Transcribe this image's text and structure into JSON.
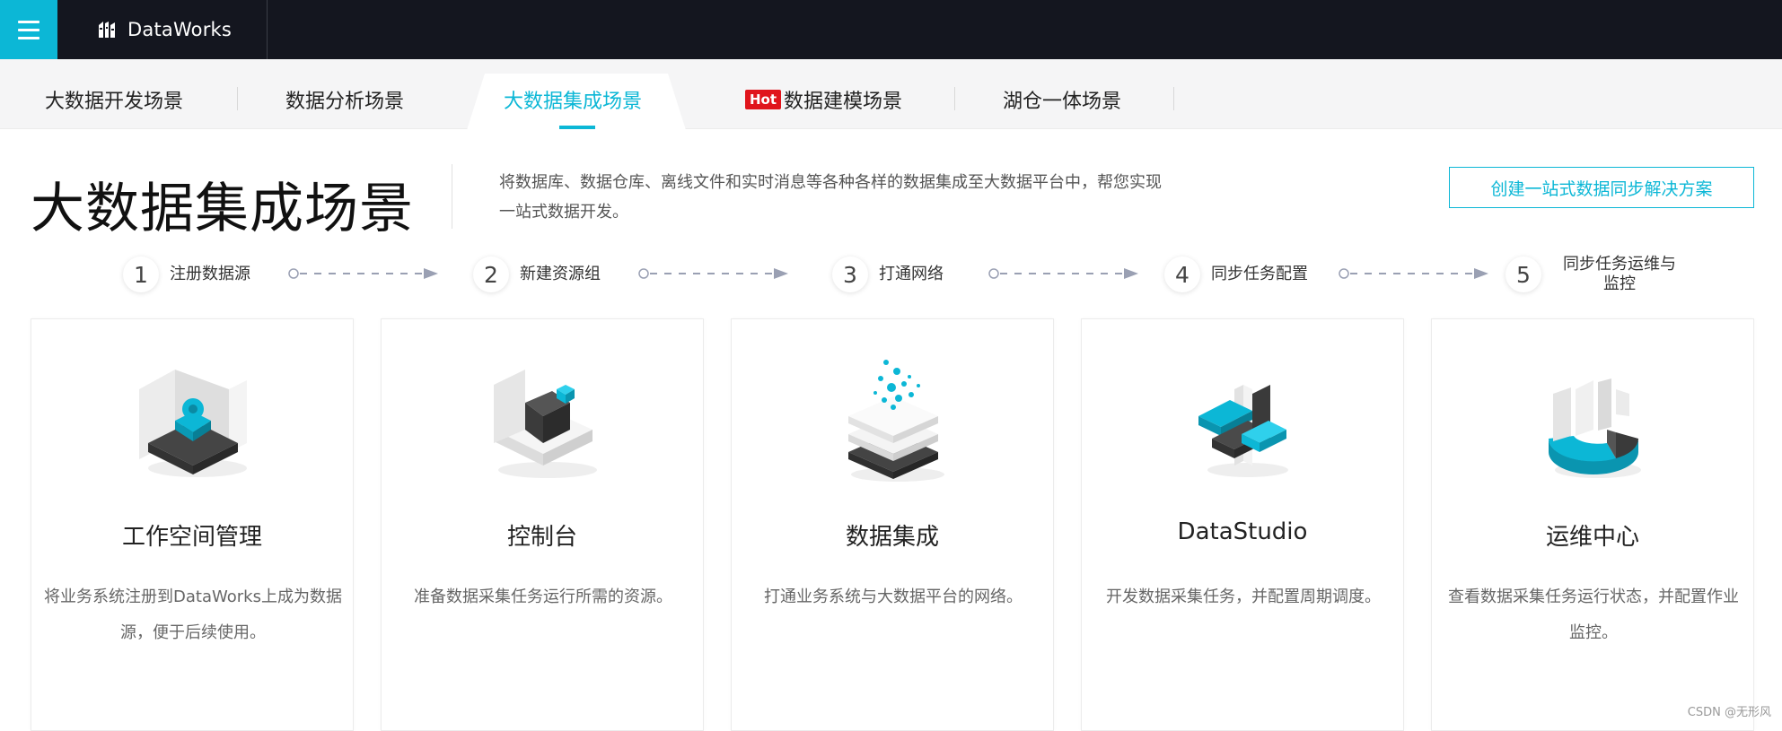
{
  "brand": {
    "name": "DataWorks",
    "accent": "#0cb7d6",
    "dark": "#14161f"
  },
  "tabs": [
    {
      "label": "大数据开发场景"
    },
    {
      "label": "数据分析场景"
    },
    {
      "label": "大数据集成场景",
      "active": true
    },
    {
      "label": "数据建模场景",
      "badge": "Hot"
    },
    {
      "label": "湖仓一体场景"
    }
  ],
  "header": {
    "title": "大数据集成场景",
    "description_line1": "将数据库、数据仓库、离线文件和实时消息等各种各样的数据集成至大数据平台中，帮您实现",
    "description_line2": "一站式数据开发。",
    "cta": "创建一站式数据同步解决方案"
  },
  "steps": [
    {
      "num": "1",
      "label": "注册数据源"
    },
    {
      "num": "2",
      "label": "新建资源组"
    },
    {
      "num": "3",
      "label": "打通网络"
    },
    {
      "num": "4",
      "label": "同步任务配置"
    },
    {
      "num": "5",
      "label_line1": "同步任务运维与",
      "label_line2": "监控"
    }
  ],
  "cards": [
    {
      "icon": "workspace-gear-icon",
      "title": "工作空间管理",
      "desc": "将业务系统注册到DataWorks上成为数据源，便于后续使用。"
    },
    {
      "icon": "console-blocks-icon",
      "title": "控制台",
      "desc": "准备数据采集任务运行所需的资源。"
    },
    {
      "icon": "data-integration-layers-icon",
      "title": "数据集成",
      "desc": "打通业务系统与大数据平台的网络。"
    },
    {
      "icon": "datastudio-cross-icon",
      "title": "DataStudio",
      "desc": "开发数据采集任务，并配置周期调度。"
    },
    {
      "icon": "ops-center-ring-icon",
      "title": "运维中心",
      "desc": "查看数据采集任务运行状态，并配置作业监控。"
    }
  ],
  "watermark": "CSDN @无形风"
}
